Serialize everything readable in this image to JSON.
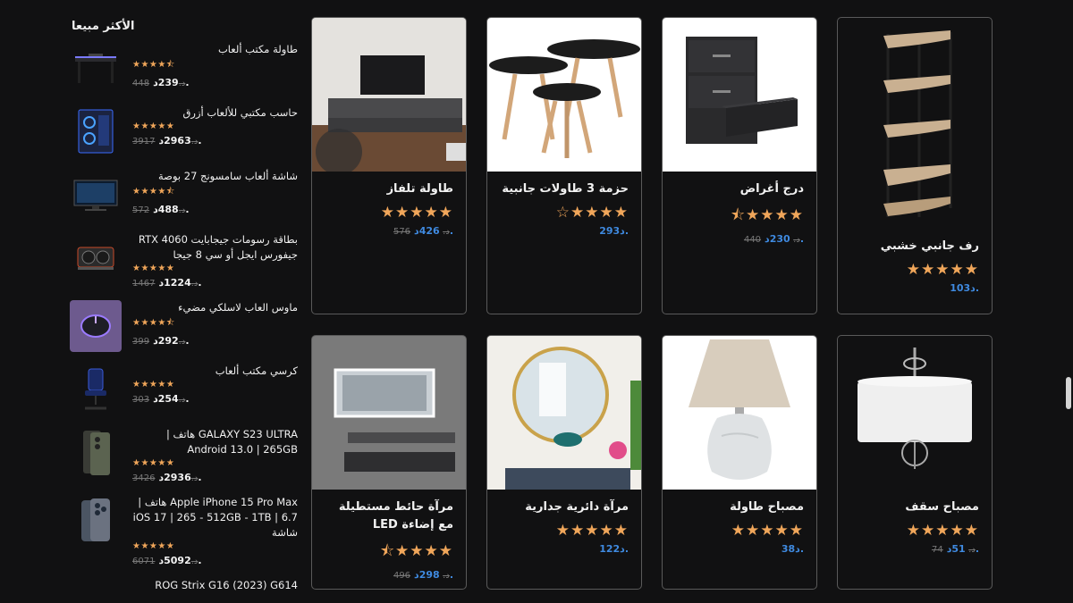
{
  "sidebar": {
    "title": "الأكثر مبيعا",
    "items": [
      {
        "name": "طاولة مكتب ألعاب",
        "stars": "★★★★⯪",
        "old": "448د.",
        "price": "239د."
      },
      {
        "name": "حاسب مكتبي للألعاب أزرق",
        "stars": "★★★★★",
        "old": "3917د.",
        "price": "2963د."
      },
      {
        "name": "شاشة ألعاب سامسونج 27 بوصة",
        "stars": "★★★★⯪",
        "old": "572د.",
        "price": "488د."
      },
      {
        "name": "بطاقة رسومات جيجابايت RTX 4060 جيفورس ايجل أو سي 8 جيجا",
        "stars": "★★★★★",
        "old": "1467د.",
        "price": "1224د."
      },
      {
        "name": "ماوس العاب لاسلكي مضيء",
        "stars": "★★★★⯪",
        "old": "399د.",
        "price": "292د."
      },
      {
        "name": "كرسي مكتب ألعاب",
        "stars": "★★★★★",
        "old": "303د.",
        "price": "254د."
      },
      {
        "name": "GALAXY S23 ULTRA هاتف | Android 13.0 | 265GB",
        "stars": "★★★★★",
        "old": "3426د.",
        "price": "2936د."
      },
      {
        "name": "Apple iPhone 15 Pro Max هاتف | iOS 17 | 265 - 512GB - 1TB | 6.7 شاشة",
        "stars": "★★★★★",
        "old": "6071د.",
        "price": "5092د."
      },
      {
        "name": "ROG Strix G16 (2023) G614",
        "stars": "",
        "old": "",
        "price": ""
      }
    ]
  },
  "products": [
    {
      "title": "رف جانبي خشبي",
      "stars": "★★★★★",
      "old": "",
      "price": "103د."
    },
    {
      "title": "درج أغراض",
      "stars": "★★★★⯪",
      "old": "440د.",
      "price": "230د."
    },
    {
      "title": "حزمة 3 طاولات جانبية",
      "stars": "★★★★☆",
      "old": "",
      "price": "293د."
    },
    {
      "title": "طاولة تلفاز",
      "stars": "★★★★★",
      "old": "576د.",
      "price": "426د."
    },
    {
      "title": "مصباح سقف",
      "stars": "★★★★★",
      "old": "74د.",
      "price": "51د."
    },
    {
      "title": "مصباح طاولة",
      "stars": "★★★★★",
      "old": "",
      "price": "38د."
    },
    {
      "title": "مرآة دائرية جدارية",
      "stars": "★★★★★",
      "old": "",
      "price": "122د."
    },
    {
      "title": "مرآة حائط مستطيلة مع إضاءة LED",
      "stars": "★★★★⯪",
      "old": "496د.",
      "price": "298د."
    }
  ],
  "colors": {
    "background": "#111112",
    "accent_price": "#3f8ae0",
    "star": "#f0a65a",
    "card_border": "#5a5a5a"
  }
}
